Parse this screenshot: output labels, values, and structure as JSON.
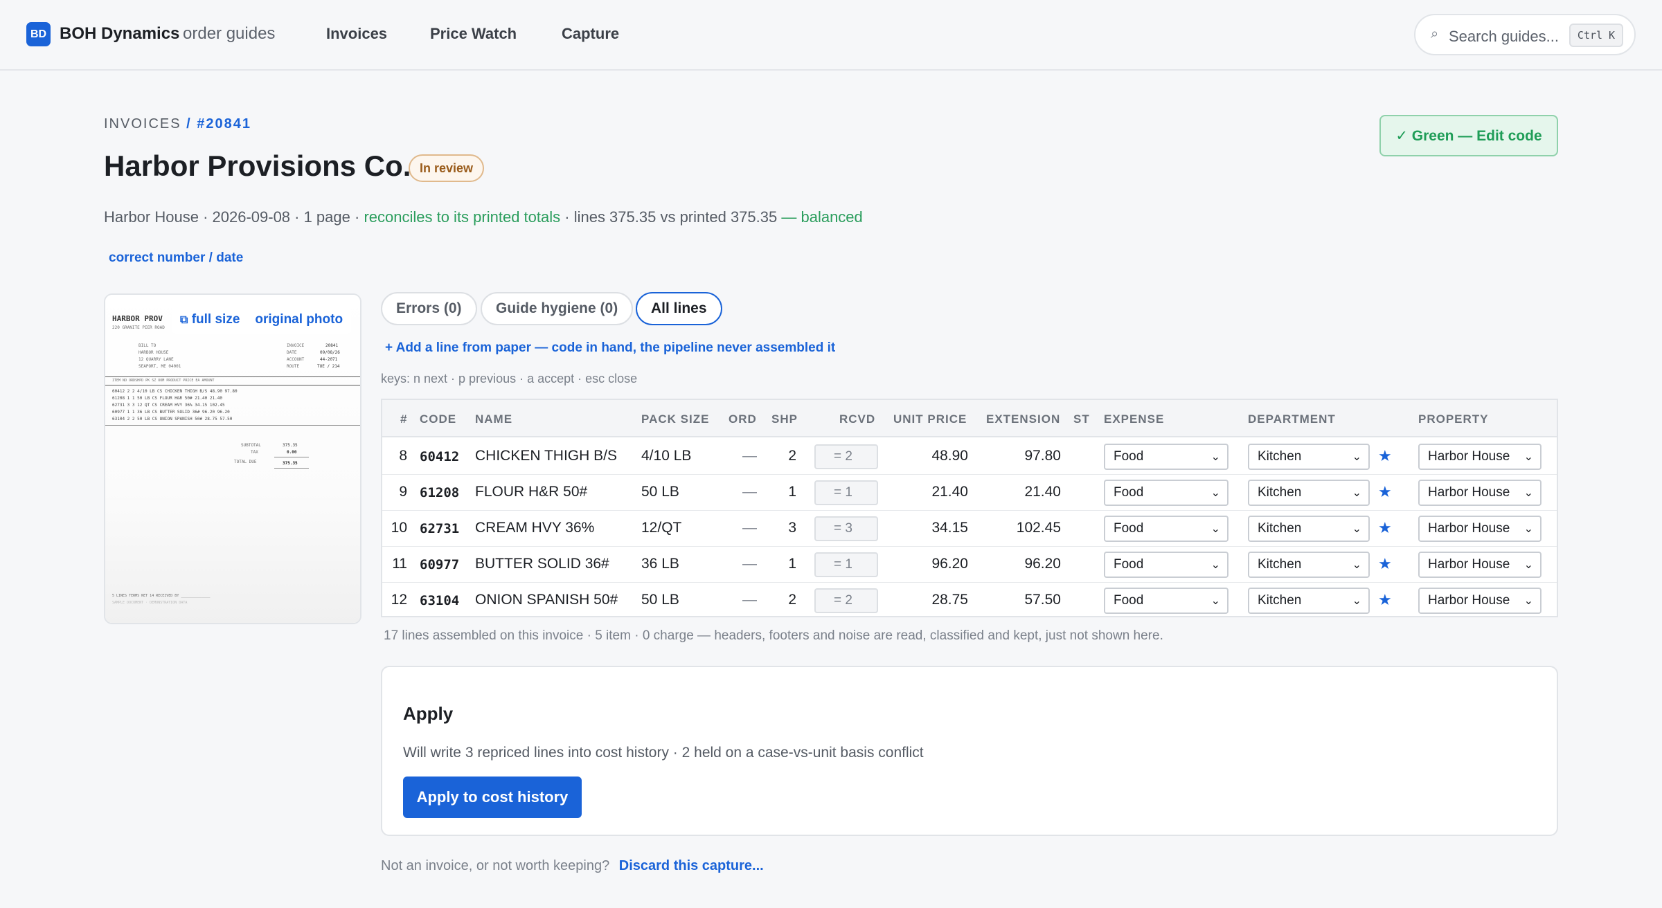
{
  "brand": {
    "badge": "BD",
    "name": "BOH Dynamics",
    "sub": "order guides"
  },
  "nav": [
    "Invoices",
    "Price Watch",
    "Capture"
  ],
  "search": {
    "placeholder": "Search guides...",
    "shortcut": "Ctrl K"
  },
  "breadcrumb": {
    "section": "INVOICES",
    "separator": "/",
    "number": "#20841"
  },
  "header": {
    "title": "Harbor Provisions Co.",
    "status": "In review",
    "edit_code": "✓ Green — Edit code",
    "meta_prefix": "Harbor House · 2026-09-08 · 1 page · ",
    "meta_reconcile": "reconciles to its printed totals",
    "meta_lines": " · lines 375.35 vs printed 375.35 ",
    "meta_balanced": "— balanced",
    "correct_link": "correct number / date"
  },
  "thumbnail": {
    "full_size": "full size",
    "original_photo": "original photo",
    "full_size_icon": "copy-icon",
    "paper_head": "HARBOR PROV",
    "paper_address": "220 GRANITE PIER ROAD",
    "paper_billto": [
      "BILL TO",
      "HARBOR HOUSE",
      "12 QUARRY LANE",
      "SEAPORT, ME 04001"
    ],
    "paper_fields": [
      [
        "INVOICE",
        "20841"
      ],
      [
        "DATE",
        "09/08/26"
      ],
      [
        "ACCOUNT",
        "44-2071"
      ],
      [
        "ROUTE",
        "TUE / 214"
      ]
    ],
    "paper_columns": "ITEM NO  ORDSHPD PK  SZ  UOM PRODUCT              PRICE EA   AMOUNT",
    "paper_lines": [
      "60412   2  2  4/10  LB  CS  CHICKEN THIGH B/S        48.90    97.80",
      "61208   1  1  50    LB  CS  FLOUR H&R 50#            21.40    21.40",
      "62731   3  3  12    QT  CS  CREAM HVY 36%            34.15   102.45",
      "60977   1  1  36    LB  CS  BUTTER SOLID 36#         96.20    96.20",
      "63104   2  2  50    LB  CS  ONION SPANISH 50#        28.75    57.50"
    ],
    "paper_totals": [
      [
        "SUBTOTAL",
        "375.35"
      ],
      [
        "TAX",
        "0.00"
      ],
      [
        "TOTAL DUE",
        "375.35"
      ]
    ],
    "paper_footer": "5 LINES     TERMS NET 14     RECEIVED BY ______________",
    "paper_footer2": "SAMPLE DOCUMENT · DEMONSTRATION DATA"
  },
  "tabs": [
    {
      "label": "Errors (0)",
      "active": false
    },
    {
      "label": "Guide hygiene (0)",
      "active": false
    },
    {
      "label": "All lines",
      "active": true
    }
  ],
  "add_line": "+ Add a line from paper — code in hand, the pipeline never assembled it",
  "keys_hint": "keys: n next · p previous · a accept · esc close",
  "table": {
    "columns": [
      "#",
      "CODE",
      "NAME",
      "PACK SIZE",
      "ORD",
      "SHP",
      "RCVD",
      "UNIT PRICE",
      "EXTENSION",
      "ST",
      "EXPENSE",
      "DEPARTMENT",
      "PROPERTY"
    ],
    "rows": [
      {
        "num": "8",
        "code": "60412",
        "name": "CHICKEN THIGH B/S",
        "pack": "4/10 LB",
        "ord": "—",
        "shp": "2",
        "rcvd": "= 2",
        "unit": "48.90",
        "ext": "97.80",
        "expense": "Food",
        "dept": "Kitchen",
        "property": "Harbor House"
      },
      {
        "num": "9",
        "code": "61208",
        "name": "FLOUR H&R 50#",
        "pack": "50 LB",
        "ord": "—",
        "shp": "1",
        "rcvd": "= 1",
        "unit": "21.40",
        "ext": "21.40",
        "expense": "Food",
        "dept": "Kitchen",
        "property": "Harbor House"
      },
      {
        "num": "10",
        "code": "62731",
        "name": "CREAM HVY 36%",
        "pack": "12/QT",
        "ord": "—",
        "shp": "3",
        "rcvd": "= 3",
        "unit": "34.15",
        "ext": "102.45",
        "expense": "Food",
        "dept": "Kitchen",
        "property": "Harbor House"
      },
      {
        "num": "11",
        "code": "60977",
        "name": "BUTTER SOLID 36#",
        "pack": "36 LB",
        "ord": "—",
        "shp": "1",
        "rcvd": "= 1",
        "unit": "96.20",
        "ext": "96.20",
        "expense": "Food",
        "dept": "Kitchen",
        "property": "Harbor House"
      },
      {
        "num": "12",
        "code": "63104",
        "name": "ONION SPANISH 50#",
        "pack": "50 LB",
        "ord": "—",
        "shp": "2",
        "rcvd": "= 2",
        "unit": "28.75",
        "ext": "57.50",
        "expense": "Food",
        "dept": "Kitchen",
        "property": "Harbor House"
      }
    ]
  },
  "assembled_note": "17 lines assembled on this invoice · 5 item · 0 charge — headers, footers and noise are read, classified and kept, just not shown here.",
  "apply": {
    "title": "Apply",
    "description": "Will write 3 repriced lines into cost history · 2 held on a case-vs-unit basis conflict",
    "button": "Apply to cost history"
  },
  "discard": {
    "prompt": "Not an invoice, or not worth keeping?",
    "link": "Discard this capture..."
  },
  "colors": {
    "accent": "#1a63d8",
    "success": "#2a9d5c",
    "warning": "#9a5c1b"
  }
}
